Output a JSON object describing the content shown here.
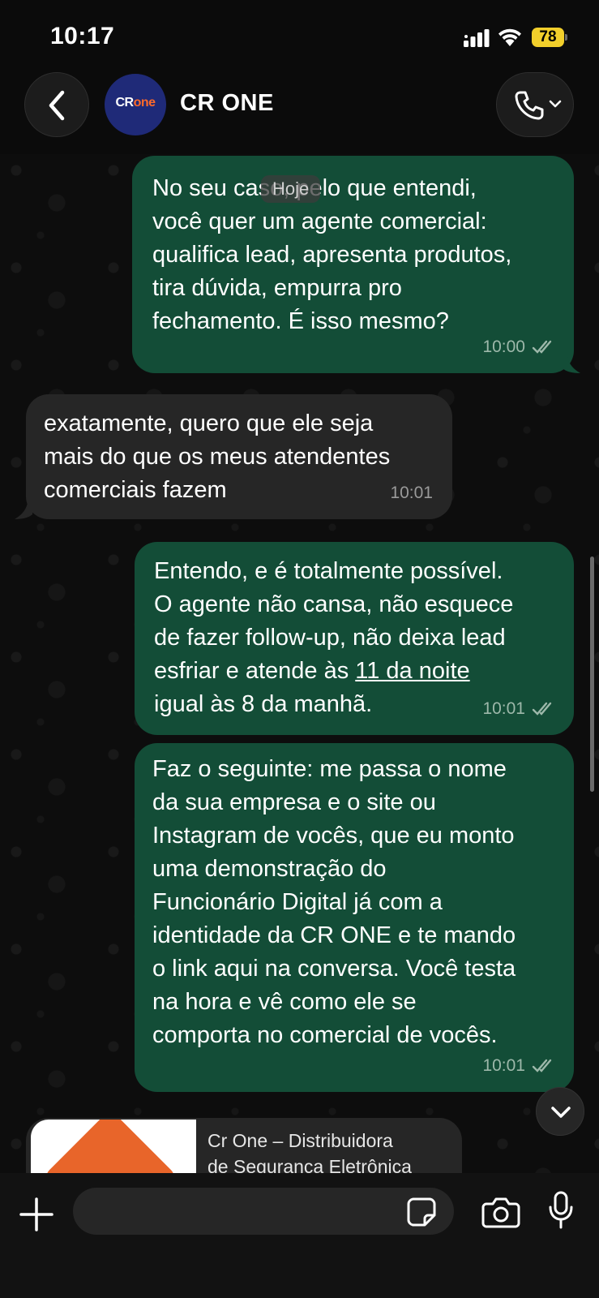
{
  "status_bar": {
    "time": "10:17",
    "battery_percent": "78",
    "icons": [
      "signal-icon",
      "wifi-icon",
      "battery-icon"
    ]
  },
  "header": {
    "contact_name": "CR ONE",
    "avatar_logo_cr": "CR",
    "avatar_logo_one": "one",
    "back_icon": "chevron-left-icon",
    "call_icon": "phone-icon"
  },
  "date_chip": "Hoje",
  "messages": [
    {
      "direction": "outgoing",
      "text": "No seu caso, pelo que entendi,\nvocê quer um agente comercial:\nqualifica lead, apresenta produtos,\ntira dúvida, empurra pro\nfechamento. É isso mesmo?",
      "time": "10:00",
      "status": "read"
    },
    {
      "direction": "incoming",
      "text": "exatamente, quero que ele seja\nmais do que os meus atendentes\ncomerciais fazem",
      "time": "10:01"
    },
    {
      "direction": "outgoing",
      "text_line1": "Entendo, e é totalmente possível.\nO agente não cansa, não esquece\nde fazer follow-up, não deixa lead\nesfriar e atende às ",
      "link": "11 da noite",
      "text_line2": "\nigual às 8 da manhã.",
      "time": "10:01",
      "status": "read"
    },
    {
      "direction": "outgoing",
      "text": "Faz o seguinte: me passa o nome\nda sua empresa e o site ou\nInstagram de vocês, que eu monto\numa demonstração do\nFuncionário Digital já com a\nidentidade da CR ONE e te mando\no link aqui na conversa. Você testa\nna hora e vê como ele se\ncomporta no comercial de vocês.",
      "time": "10:01",
      "status": "read"
    }
  ],
  "link_preview": {
    "title": "Cr One – Distribuidora\nde Segurança Eletrônica"
  },
  "input_bar": {
    "placeholder": "",
    "icons": [
      "plus-icon",
      "sticker-icon",
      "camera-icon",
      "microphone-icon"
    ]
  },
  "colors": {
    "outgoing_bubble": "#134d37",
    "incoming_bubble": "#262626",
    "battery": "#f2cf2b",
    "avatar_bg": "#1f2a78"
  }
}
